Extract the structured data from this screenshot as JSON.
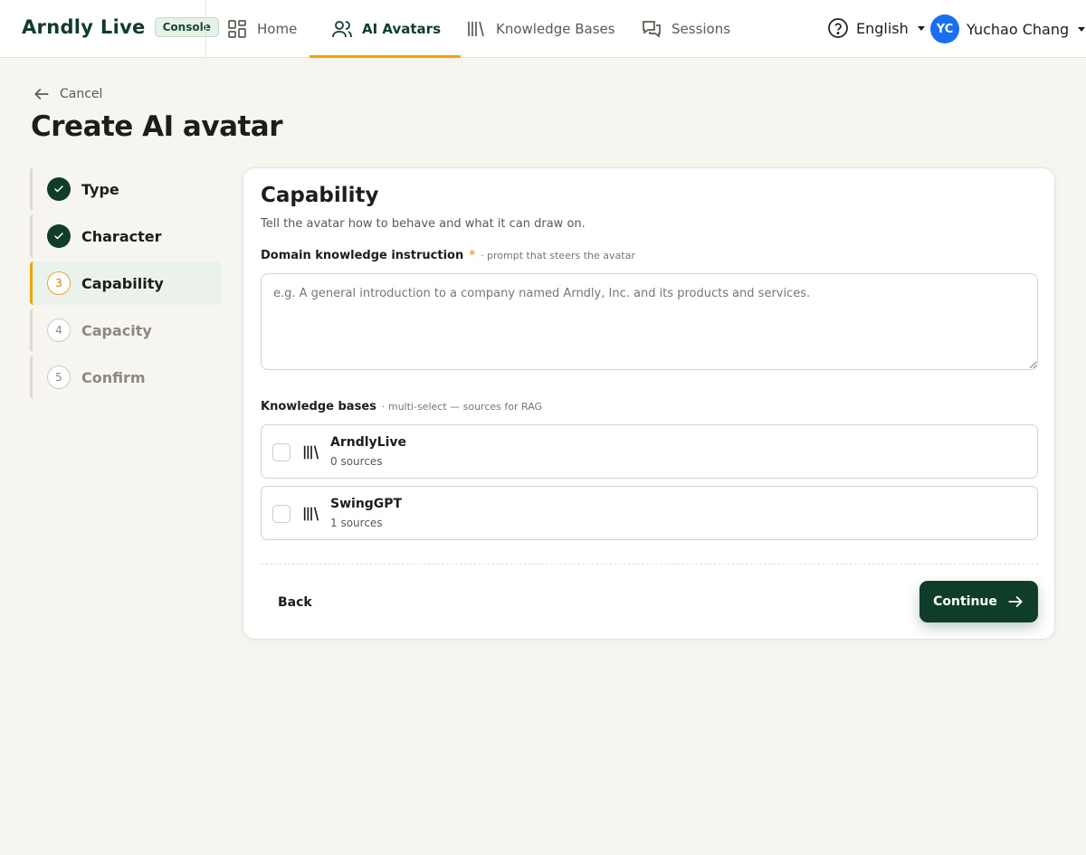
{
  "brand": {
    "logo": "Arndly Live",
    "badge": "Console"
  },
  "nav": {
    "home": "Home",
    "avatars": "AI Avatars",
    "knowledge_bases": "Knowledge Bases",
    "sessions": "Sessions"
  },
  "header": {
    "language": "English",
    "user_initials": "YC",
    "user_name": "Yuchao Chang"
  },
  "page": {
    "cancel_label": "Cancel",
    "title": "Create AI avatar"
  },
  "steps": [
    {
      "number": "1",
      "label": "Type",
      "state": "done"
    },
    {
      "number": "2",
      "label": "Character",
      "state": "done"
    },
    {
      "number": "3",
      "label": "Capability",
      "state": "current"
    },
    {
      "number": "4",
      "label": "Capacity",
      "state": "todo"
    },
    {
      "number": "5",
      "label": "Confirm",
      "state": "todo"
    }
  ],
  "form": {
    "title": "Capability",
    "description": "Tell the avatar how to behave and what it can draw on.",
    "instruction": {
      "label": "Domain knowledge instruction",
      "required_mark": "*",
      "hint": "· prompt that steers the avatar",
      "value": "",
      "placeholder": "e.g. A general introduction to a company named Arndly, Inc. and its products and services."
    },
    "knowledge_bases": {
      "label": "Knowledge bases",
      "hint": "· multi-select — sources for RAG",
      "items": [
        {
          "name": "ArndlyLive",
          "sources": "0 sources",
          "checked": false
        },
        {
          "name": "SwingGPT",
          "sources": "1 sources",
          "checked": false
        }
      ]
    },
    "back_label": "Back",
    "continue_label": "Continue"
  },
  "colors": {
    "brand_green": "#0f3d2a",
    "accent_orange": "#f0a500",
    "avatar_blue": "#1a6ef0",
    "background": "#f7f5f0"
  },
  "icons": {
    "home": "grid-icon",
    "avatars": "users-icon",
    "knowledge_bases": "library-icon",
    "sessions": "chat-bubbles-icon",
    "help": "help-circle-icon",
    "cancel": "arrow-left-icon",
    "step_done": "check-icon",
    "continue": "arrow-right-icon"
  }
}
